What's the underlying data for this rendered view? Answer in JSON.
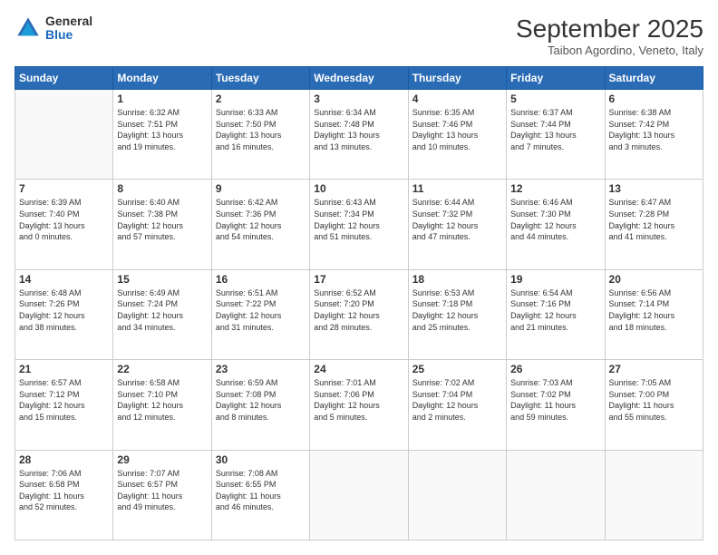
{
  "header": {
    "logo_general": "General",
    "logo_blue": "Blue",
    "month_title": "September 2025",
    "subtitle": "Taibon Agordino, Veneto, Italy"
  },
  "weekdays": [
    "Sunday",
    "Monday",
    "Tuesday",
    "Wednesday",
    "Thursday",
    "Friday",
    "Saturday"
  ],
  "weeks": [
    [
      {
        "day": "",
        "info": ""
      },
      {
        "day": "1",
        "info": "Sunrise: 6:32 AM\nSunset: 7:51 PM\nDaylight: 13 hours\nand 19 minutes."
      },
      {
        "day": "2",
        "info": "Sunrise: 6:33 AM\nSunset: 7:50 PM\nDaylight: 13 hours\nand 16 minutes."
      },
      {
        "day": "3",
        "info": "Sunrise: 6:34 AM\nSunset: 7:48 PM\nDaylight: 13 hours\nand 13 minutes."
      },
      {
        "day": "4",
        "info": "Sunrise: 6:35 AM\nSunset: 7:46 PM\nDaylight: 13 hours\nand 10 minutes."
      },
      {
        "day": "5",
        "info": "Sunrise: 6:37 AM\nSunset: 7:44 PM\nDaylight: 13 hours\nand 7 minutes."
      },
      {
        "day": "6",
        "info": "Sunrise: 6:38 AM\nSunset: 7:42 PM\nDaylight: 13 hours\nand 3 minutes."
      }
    ],
    [
      {
        "day": "7",
        "info": "Sunrise: 6:39 AM\nSunset: 7:40 PM\nDaylight: 13 hours\nand 0 minutes."
      },
      {
        "day": "8",
        "info": "Sunrise: 6:40 AM\nSunset: 7:38 PM\nDaylight: 12 hours\nand 57 minutes."
      },
      {
        "day": "9",
        "info": "Sunrise: 6:42 AM\nSunset: 7:36 PM\nDaylight: 12 hours\nand 54 minutes."
      },
      {
        "day": "10",
        "info": "Sunrise: 6:43 AM\nSunset: 7:34 PM\nDaylight: 12 hours\nand 51 minutes."
      },
      {
        "day": "11",
        "info": "Sunrise: 6:44 AM\nSunset: 7:32 PM\nDaylight: 12 hours\nand 47 minutes."
      },
      {
        "day": "12",
        "info": "Sunrise: 6:46 AM\nSunset: 7:30 PM\nDaylight: 12 hours\nand 44 minutes."
      },
      {
        "day": "13",
        "info": "Sunrise: 6:47 AM\nSunset: 7:28 PM\nDaylight: 12 hours\nand 41 minutes."
      }
    ],
    [
      {
        "day": "14",
        "info": "Sunrise: 6:48 AM\nSunset: 7:26 PM\nDaylight: 12 hours\nand 38 minutes."
      },
      {
        "day": "15",
        "info": "Sunrise: 6:49 AM\nSunset: 7:24 PM\nDaylight: 12 hours\nand 34 minutes."
      },
      {
        "day": "16",
        "info": "Sunrise: 6:51 AM\nSunset: 7:22 PM\nDaylight: 12 hours\nand 31 minutes."
      },
      {
        "day": "17",
        "info": "Sunrise: 6:52 AM\nSunset: 7:20 PM\nDaylight: 12 hours\nand 28 minutes."
      },
      {
        "day": "18",
        "info": "Sunrise: 6:53 AM\nSunset: 7:18 PM\nDaylight: 12 hours\nand 25 minutes."
      },
      {
        "day": "19",
        "info": "Sunrise: 6:54 AM\nSunset: 7:16 PM\nDaylight: 12 hours\nand 21 minutes."
      },
      {
        "day": "20",
        "info": "Sunrise: 6:56 AM\nSunset: 7:14 PM\nDaylight: 12 hours\nand 18 minutes."
      }
    ],
    [
      {
        "day": "21",
        "info": "Sunrise: 6:57 AM\nSunset: 7:12 PM\nDaylight: 12 hours\nand 15 minutes."
      },
      {
        "day": "22",
        "info": "Sunrise: 6:58 AM\nSunset: 7:10 PM\nDaylight: 12 hours\nand 12 minutes."
      },
      {
        "day": "23",
        "info": "Sunrise: 6:59 AM\nSunset: 7:08 PM\nDaylight: 12 hours\nand 8 minutes."
      },
      {
        "day": "24",
        "info": "Sunrise: 7:01 AM\nSunset: 7:06 PM\nDaylight: 12 hours\nand 5 minutes."
      },
      {
        "day": "25",
        "info": "Sunrise: 7:02 AM\nSunset: 7:04 PM\nDaylight: 12 hours\nand 2 minutes."
      },
      {
        "day": "26",
        "info": "Sunrise: 7:03 AM\nSunset: 7:02 PM\nDaylight: 11 hours\nand 59 minutes."
      },
      {
        "day": "27",
        "info": "Sunrise: 7:05 AM\nSunset: 7:00 PM\nDaylight: 11 hours\nand 55 minutes."
      }
    ],
    [
      {
        "day": "28",
        "info": "Sunrise: 7:06 AM\nSunset: 6:58 PM\nDaylight: 11 hours\nand 52 minutes."
      },
      {
        "day": "29",
        "info": "Sunrise: 7:07 AM\nSunset: 6:57 PM\nDaylight: 11 hours\nand 49 minutes."
      },
      {
        "day": "30",
        "info": "Sunrise: 7:08 AM\nSunset: 6:55 PM\nDaylight: 11 hours\nand 46 minutes."
      },
      {
        "day": "",
        "info": ""
      },
      {
        "day": "",
        "info": ""
      },
      {
        "day": "",
        "info": ""
      },
      {
        "day": "",
        "info": ""
      }
    ]
  ]
}
